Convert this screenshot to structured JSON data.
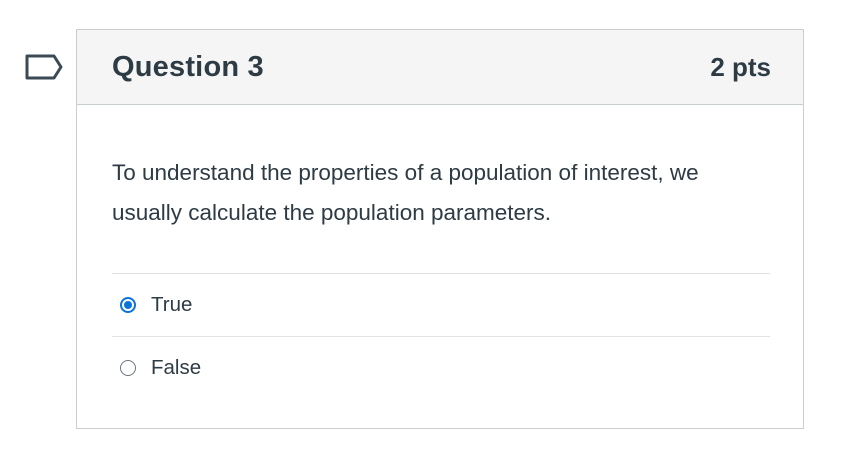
{
  "question": {
    "title": "Question 3",
    "points": "2 pts",
    "text": "To understand the properties of a population of interest, we usually calculate the population parameters.",
    "flag_icon": "flag-icon"
  },
  "answers": [
    {
      "label": "True",
      "selected": true
    },
    {
      "label": "False",
      "selected": false
    }
  ],
  "colors": {
    "accent": "#0b74d9",
    "text": "#2d3b45",
    "header_bg": "#f5f5f5",
    "border": "#c7cdd1"
  }
}
